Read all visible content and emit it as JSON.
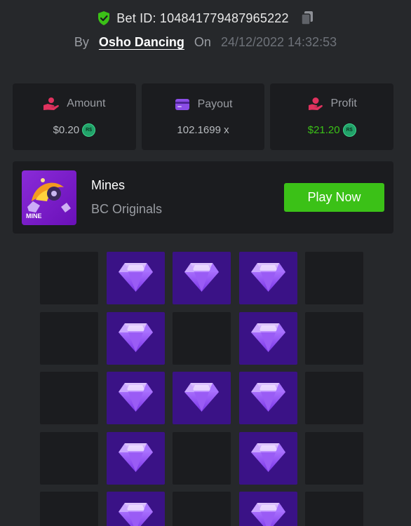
{
  "bet": {
    "id_label": "Bet ID: 104841779487965222",
    "by_label": "By",
    "username": "Osho Dancing",
    "on_label": "On",
    "datetime": "24/12/2022 14:32:53"
  },
  "stats": {
    "amount": {
      "label": "Amount",
      "value": "$0.20",
      "coin": "R$",
      "icon": "hand-coin-icon",
      "icon_color": "#e0325e"
    },
    "payout": {
      "label": "Payout",
      "value": "102.1699 x",
      "icon": "wallet-card-icon",
      "icon_color": "#8b4de6"
    },
    "profit": {
      "label": "Profit",
      "value": "$21.20",
      "coin": "R$",
      "icon": "hand-money-icon",
      "icon_color": "#e0325e",
      "value_color": "#3bc117"
    }
  },
  "game": {
    "name": "Mines",
    "provider": "BC Originals",
    "thumb_text": "MINE",
    "play_label": "Play Now"
  },
  "board": {
    "columns": 5,
    "cells": [
      "empty",
      "gem",
      "gem",
      "gem",
      "empty",
      "empty",
      "gem",
      "empty",
      "gem",
      "empty",
      "empty",
      "gem",
      "gem",
      "gem",
      "empty",
      "empty",
      "gem",
      "empty",
      "gem",
      "empty",
      "empty",
      "gem",
      "empty",
      "gem",
      "empty"
    ]
  },
  "colors": {
    "background": "#26282b",
    "card": "#1b1c1f",
    "accent_green": "#3bc117",
    "gem_tile": "#3a1286"
  }
}
